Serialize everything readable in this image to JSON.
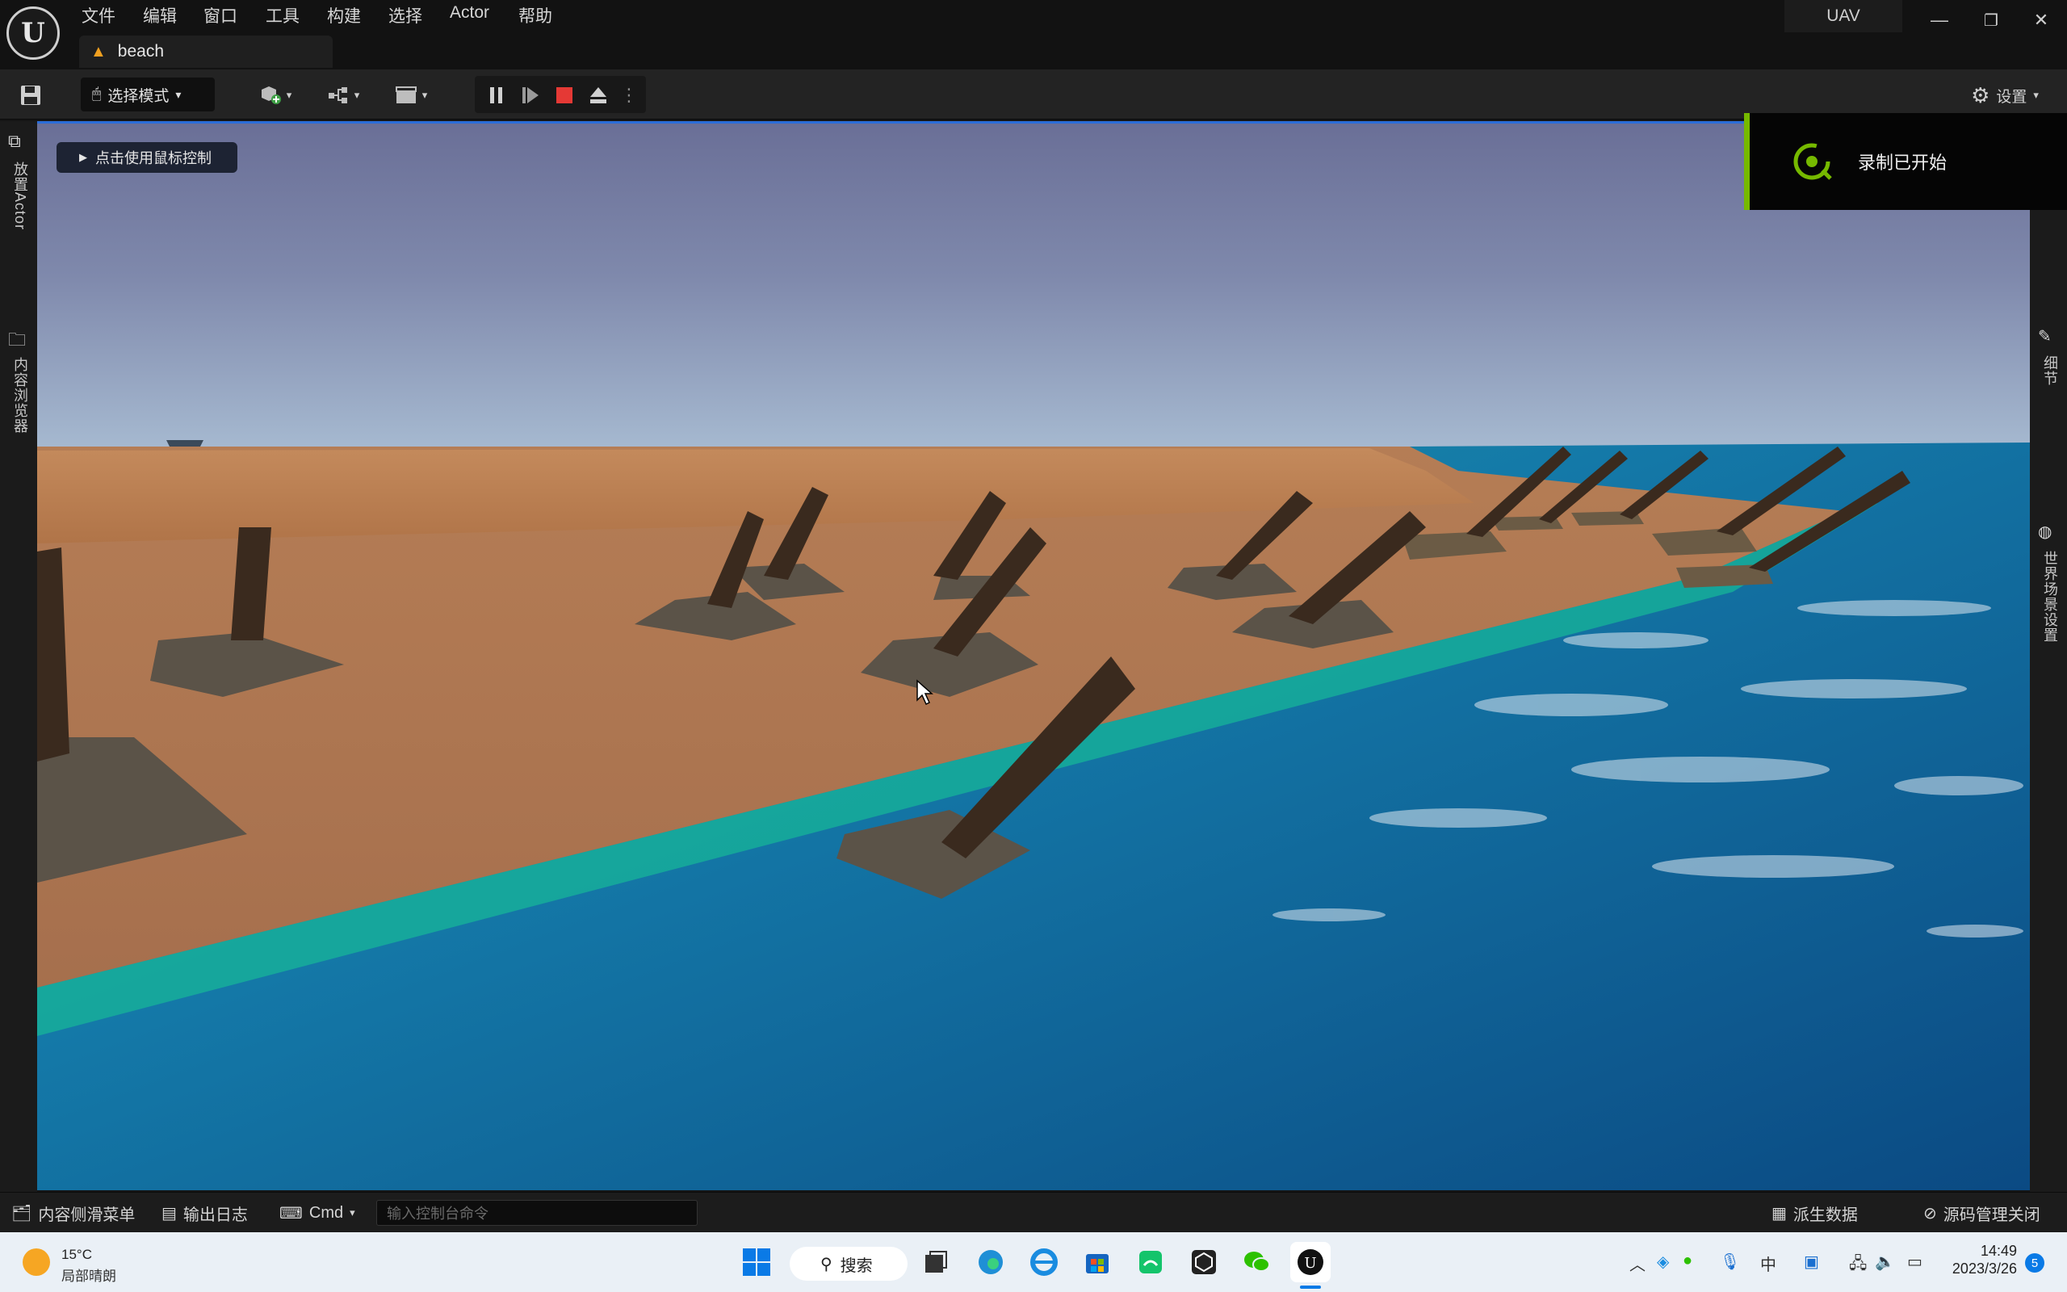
{
  "colors": {
    "accent": "#2a6dd8",
    "nvidia_green": "#76b900",
    "stop_red": "#e53935"
  },
  "menu": [
    "文件",
    "编辑",
    "窗口",
    "工具",
    "构建",
    "选择",
    "Actor",
    "帮助"
  ],
  "tab": {
    "label": "beach",
    "icon": "level-icon"
  },
  "project_name": "UAV",
  "toolbar": {
    "mode_label": "选择模式",
    "settings_label": "设置"
  },
  "left_rail": {
    "place_actor": "放置Actor",
    "content_browser": "内容浏览器"
  },
  "right_rail": {
    "details": "细节",
    "world_settings": "世界场景设置"
  },
  "viewport": {
    "mouse_hint": "点击使用鼠标控制"
  },
  "toast": {
    "text": "录制已开始"
  },
  "bottom": {
    "content_drawer": "内容侧滑菜单",
    "output_log": "输出日志",
    "cmd": "Cmd",
    "cmd_placeholder": "输入控制台命令",
    "derived_data": "派生数据",
    "source_control": "源码管理关闭"
  },
  "taskbar": {
    "weather_temp": "15°C",
    "weather_desc": "局部晴朗",
    "search": "搜索",
    "time": "14:49",
    "date": "2023/3/26",
    "notification_count": "5"
  }
}
